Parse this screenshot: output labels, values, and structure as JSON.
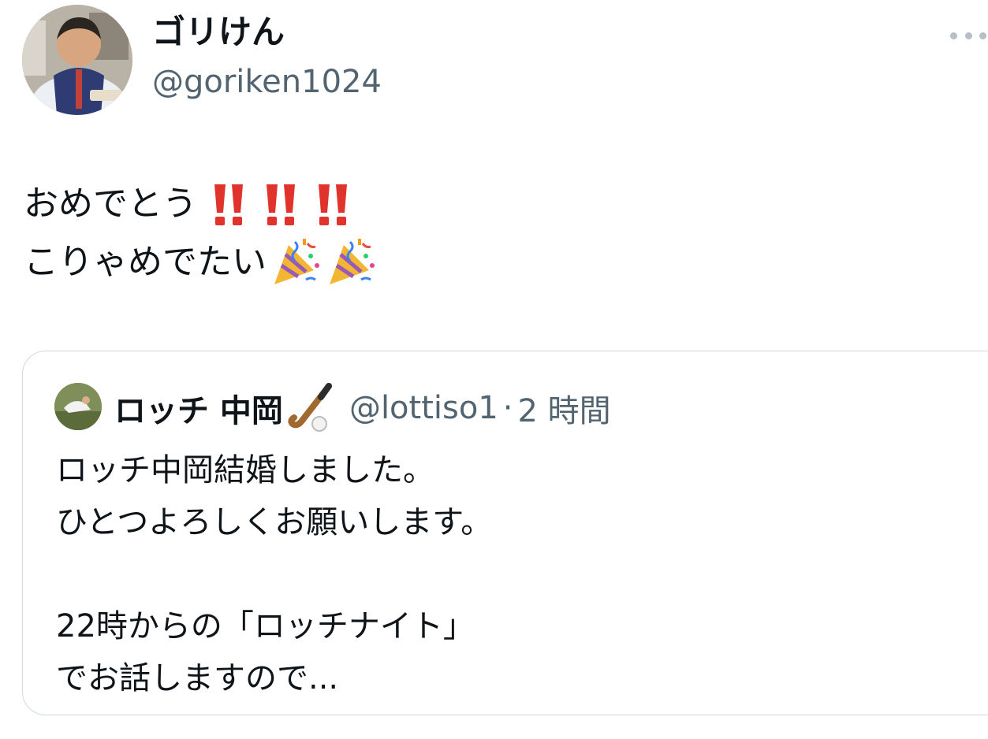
{
  "tweet": {
    "author": {
      "display_name": "ゴリけん",
      "handle": "@goriken1024",
      "avatar_icon": "user-avatar-photo"
    },
    "more_icon": "more-horizontal-icon",
    "text_line1": "おめでとう",
    "text_line2": "こりゃめでたい",
    "emoji_line1": "double-exclamation-icon x3",
    "emoji_line2": "party-popper-icon x2"
  },
  "quote": {
    "author": {
      "display_name": "ロッチ 中岡",
      "handle": "@lottiso1",
      "separator": "·",
      "time": "2 時間",
      "name_emoji": "field-hockey-icon"
    },
    "text": "ロッチ中岡結婚しました。\nひとつよろしくお願いします。\n\n22時からの「ロッチナイト」\nでお話しますので..."
  },
  "colors": {
    "text": "#0f1419",
    "secondary": "#536471",
    "border": "#cfd9de",
    "exclamation": "#e0332b"
  }
}
